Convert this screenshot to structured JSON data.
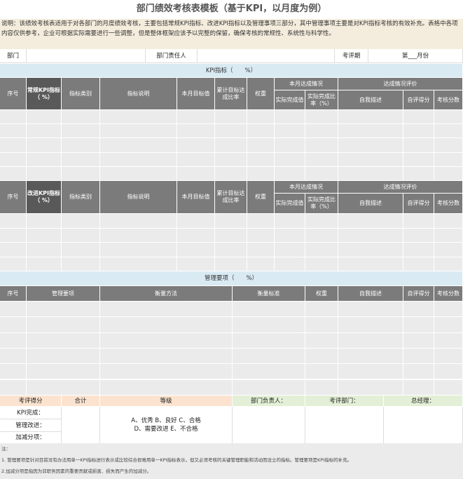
{
  "title": "部门绩效考核表模板（基于KPI，以月度为例）",
  "description": "说明：该绩效考核表适用于对各部门的月度绩效考核，主要包括常规KPI指标、改进KPI指标以及管理事项三部分，其中管理事项主要是对KPI指标考核的有效补充。表格中各项内容仅供参考，企业可根据实际需要进行一些调整，但是整体框架应该予以完整的保留，确保考核的常规性、系统性与科学性。",
  "info": {
    "dept_label": "部门",
    "head_label": "部门责任人",
    "period_label": "考评期",
    "period_value": "第___月份"
  },
  "kpi_band": "KPI指标（　　%）",
  "kpi_headers": {
    "seq": "序号",
    "regular": "常规KPI指标（ %）",
    "improve": "改进KPI指标（ %）",
    "type": "指标类别",
    "desc": "指标说明",
    "target": "本月目标值",
    "cum": "累计目标达成比率",
    "weight": "权重",
    "monthly": "本月达成情况",
    "actual": "实际完成值",
    "ratio": "实际完成比率（%）",
    "eval": "达成情况评价",
    "self_desc": "自我描述",
    "self_score": "自评得分",
    "audit": "考核分数"
  },
  "mgmt_band": "管理要项（　　%）",
  "mgmt_headers": {
    "seq": "序号",
    "item": "管理要项",
    "method": "衡量方法",
    "standard": "衡量标准",
    "weight": "权重",
    "self_desc": "自我描述",
    "self_score": "自评得分",
    "audit": "考核分数"
  },
  "summary": {
    "score_label": "考评得分",
    "total_label": "合计",
    "grade_label": "等级",
    "dept_head": "部门负责人：",
    "audit_dept": "考评部门：",
    "gm": "总经理：",
    "kpi_done": "KPI完成：",
    "mgmt_improve": "管理改进：",
    "bonus": "加减分项：",
    "grades_1": "A、优秀  B、良好  C、合格",
    "grades_2": "D、需要改进  E、不合格"
  },
  "notes": {
    "title": "注：",
    "n1": "1. 管理要项是针对目前没有办法用单一KPI指标进行表示或比较综合很难用单一KPI指标表示，但又必须考核的关键管理职能和活动而设立的指标。管理要项是KPI指标的补充。",
    "n2": "2.加减分项是指因为非职务因素的重要贡献或损害、损失而产生的加减分。"
  }
}
